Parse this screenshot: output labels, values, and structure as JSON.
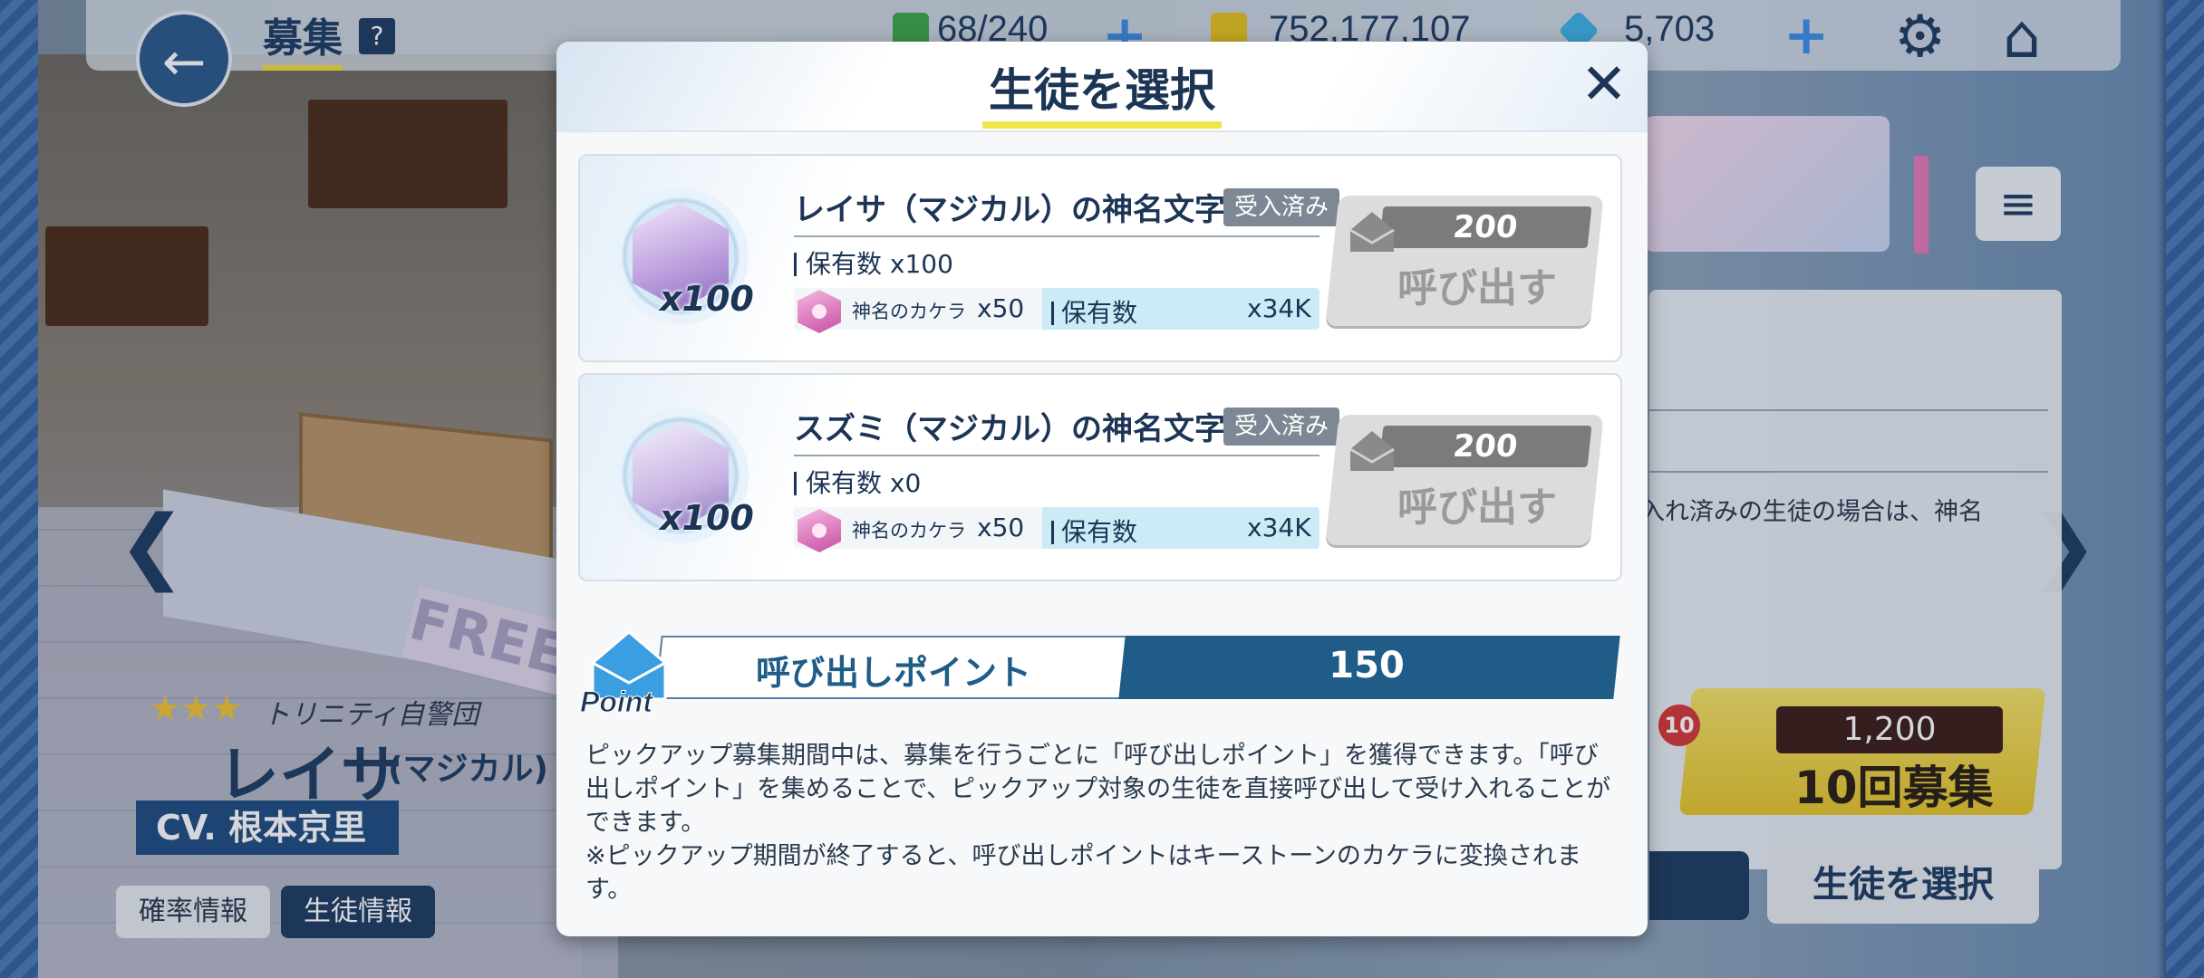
{
  "header": {
    "title": "募集",
    "help": "?",
    "ap": "68/240",
    "credits": "752,177,107",
    "gems": "5,703"
  },
  "background": {
    "free_banner": "FREE",
    "chara": {
      "stars": "★★★",
      "school": "トリニティ自警団",
      "name": "レイサ",
      "variant": "(マジカル)",
      "cv": "CV. 根本京里"
    },
    "tabs": [
      "確率情報",
      "生徒情報"
    ],
    "right_panel_text": "入れ済みの生徒の場合は、神名",
    "recruit": {
      "badge": "10",
      "cost": "1,200",
      "label": "10回募集"
    },
    "select_button": "生徒を選択"
  },
  "modal": {
    "title": "生徒を選択",
    "items": [
      {
        "name": "レイサ（マジカル）の神名文字",
        "badge": "受入済み",
        "portrait_qty": "x100",
        "own": "保有数 x100",
        "fragment_name": "神名のカケラ",
        "fragment_cost": "x50",
        "fragment_own_label": "保有数",
        "fragment_own_value": "x34K",
        "call_cost": "200",
        "call_label": "呼び出す"
      },
      {
        "name": "スズミ（マジカル）の神名文字",
        "badge": "受入済み",
        "portrait_qty": "x100",
        "own": "保有数 x0",
        "fragment_name": "神名のカケラ",
        "fragment_cost": "x50",
        "fragment_own_label": "保有数",
        "fragment_own_value": "x34K",
        "call_cost": "200",
        "call_label": "呼び出す"
      }
    ],
    "point_icon_text": "Point",
    "points_label": "呼び出しポイント",
    "points_value": "150",
    "description_1": "ピックアップ募集期間中は、募集を行うごとに「呼び出しポイント」を獲得できます。「呼び出しポイント」を集めることで、ピックアップ対象の生徒を直接呼び出して受け入れることができます。",
    "description_2": "※ピックアップ期間が終了すると、呼び出しポイントはキーストーンのカケラに変換されます。"
  }
}
